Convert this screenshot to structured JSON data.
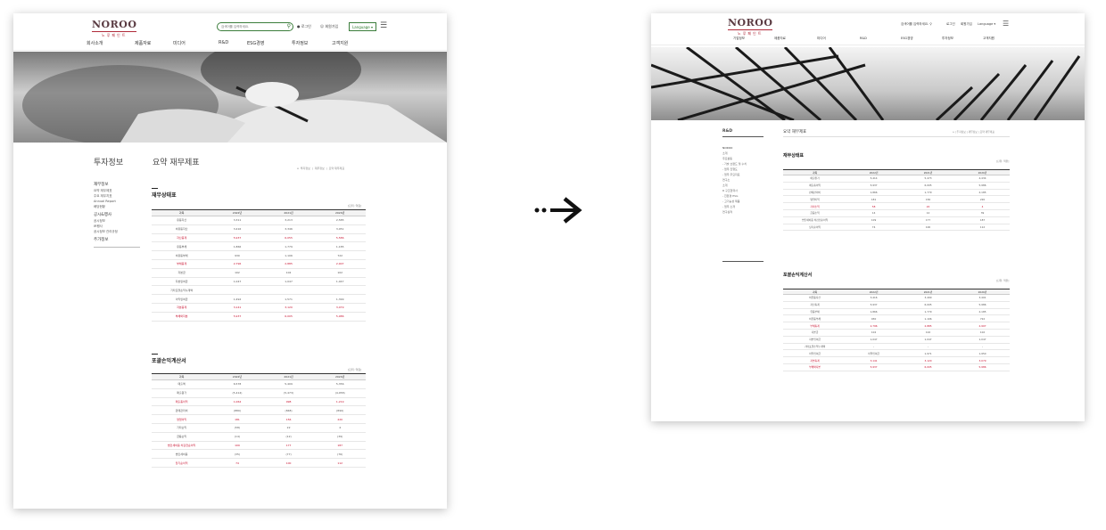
{
  "left": {
    "header": {
      "logo": "NOROO",
      "logo_sub": "노루페인트",
      "search_placeholder": "검색어를 입력하세요.",
      "login": "로그인",
      "join": "회원가입",
      "language": "Language",
      "nav": [
        "회사소개",
        "제품자료",
        "미디어",
        "R&D",
        "ESG경영",
        "투자정보",
        "고객지원"
      ]
    },
    "section_title": "투자정보",
    "page_title": "요약 재무제표",
    "breadcrumb": [
      "투자정보",
      "재무정보",
      "요약 재무제표"
    ],
    "sidebar": {
      "groups": [
        {
          "label": "재무정보",
          "active": true,
          "items": [
            "요약 재무제표",
            "주요 재무지표",
            "Annual Report",
            "배당현황"
          ]
        },
        {
          "label": "공시&행사",
          "active": false,
          "items": [
            "공시정보",
            "IR행사",
            "공시정보 관리규정"
          ]
        },
        {
          "label": "주가정보",
          "active": false,
          "items": []
        }
      ]
    },
    "balance": {
      "title": "재무상태표",
      "unit": "[단위: 억원]",
      "headers": [
        "과목",
        "2022년",
        "2021년",
        "2020년"
      ],
      "rows": [
        {
          "cells": [
            "유동자산",
            "3,311",
            "3,213",
            "2,585"
          ],
          "red": false
        },
        {
          "cells": [
            "비유동자산",
            "3,416",
            "3,346",
            "3,051"
          ],
          "red": false
        },
        {
          "cells": [
            "자산총계",
            "5,937",
            "6,055",
            "5,586"
          ],
          "red": true
        },
        {
          "cells": [
            "유동부채",
            "1,866",
            "1,779",
            "1,185"
          ],
          "red": false
        },
        {
          "cells": [
            "비유동부채",
            "930",
            "1,106",
            "722"
          ],
          "red": false
        },
        {
          "cells": [
            "부채총계",
            "2,796",
            "2,885",
            "2,907"
          ],
          "red": true
        },
        {
          "cells": [
            "자본금",
            "102",
            "102",
            "102"
          ],
          "red": false
        },
        {
          "cells": [
            "자본잉여금",
            "1,047",
            "1,047",
            "1,047"
          ],
          "red": false
        },
        {
          "cells": [
            "기타포괄손익누계액",
            "",
            "",
            ""
          ],
          "red": false
        },
        {
          "cells": [
            "이익잉여금",
            "1,492",
            "1,571",
            "1,399"
          ],
          "red": false
        },
        {
          "cells": [
            "자본총계",
            "3,141",
            "3,120",
            "3,079"
          ],
          "red": true
        },
        {
          "cells": [
            "부채와자본",
            "5,937",
            "6,005",
            "5,986"
          ],
          "red": true
        }
      ]
    },
    "income": {
      "title": "포괄손익계산서",
      "unit": "[단위: 억원]",
      "headers": [
        "과목",
        "2022년",
        "2021년",
        "2020년"
      ],
      "rows": [
        {
          "cells": [
            "매출액",
            "6,578",
            "5,409",
            "5,356"
          ],
          "red": false
        },
        {
          "cells": [
            "매출원가",
            "(5,414)",
            "(5,473)",
            "(4,058)"
          ],
          "red": false
        },
        {
          "cells": [
            "매출총이익",
            "1,064",
            "998",
            "1,219"
          ],
          "red": true
        },
        {
          "cells": [
            "판매관리비",
            "(889)",
            "(848)",
            "(890)"
          ],
          "red": false
        },
        {
          "cells": [
            "영업이익",
            "181",
            "156",
            "220"
          ],
          "red": true
        },
        {
          "cells": [
            "기타손익",
            "(58)",
            "22",
            "4"
          ],
          "red": false
        },
        {
          "cells": [
            "금융손익",
            "(14)",
            "(12)",
            "(39)"
          ],
          "red": false
        },
        {
          "cells": [
            "법인세비용 차감전순이익",
            "109",
            "177",
            "187"
          ],
          "red": true
        },
        {
          "cells": [
            "법인세비용",
            "(35)",
            "(77)",
            "(76)"
          ],
          "red": false
        },
        {
          "cells": [
            "당기순이익",
            "74",
            "100",
            "112"
          ],
          "red": true
        }
      ]
    }
  },
  "right": {
    "header": {
      "logo": "NOROO",
      "logo_sub": "노루페인트",
      "search_placeholder": "검색어를 입력하세요.",
      "login": "로그인",
      "join": "회원가입",
      "language": "Language",
      "nav": [
        "기업정보",
        "제품자료",
        "미디어",
        "R&D",
        "ESG경영",
        "투자정보",
        "고객지원"
      ]
    },
    "section_title": "R&D",
    "page_title": "요약 재무제표",
    "breadcrumb": [
      "투자정보",
      "재무정보",
      "요약 재무제표"
    ],
    "sidebar": [
      "NOROO",
      "소개",
      "주요활동",
      "- 기술 브랜드 및 수치",
      "- 업무 진행도",
      "- 업무 주요지표",
      "연구소",
      "소개",
      "R 구조협력사",
      "- 친환경 ESG",
      "- 고기능성 제품",
      "- 업무 소개",
      "연구실적"
    ],
    "balance": {
      "title": "재무상태표",
      "unit": "[단위: 억원]",
      "headers": [
        "과목",
        "2022년",
        "2021년",
        "2020년"
      ],
      "rows": [
        {
          "cells": [
            "매출원가",
            "5,414",
            "5,473",
            "4,434"
          ],
          "red": false
        },
        {
          "cells": [
            "매출총이익",
            "5,937",
            "6,005",
            "5,986"
          ],
          "red": false
        },
        {
          "cells": [
            "판매관리비",
            "1,866",
            "1,779",
            "2,185"
          ],
          "red": false
        },
        {
          "cells": [
            "영업이익",
            "181",
            "156",
            "220"
          ],
          "red": false
        },
        {
          "cells": [
            "기타손익",
            "58",
            "22",
            "4"
          ],
          "red": true
        },
        {
          "cells": [
            "금융손익",
            "14",
            "12",
            "39"
          ],
          "red": false
        },
        {
          "cells": [
            "법인세비용 차감전순이익",
            "109",
            "177",
            "187"
          ],
          "red": false
        },
        {
          "cells": [
            "당기순이익",
            "74",
            "100",
            "112"
          ],
          "red": false
        }
      ]
    },
    "income": {
      "title": "포괄손익계산서",
      "unit": "[단위: 억원]",
      "headers": [
        "과목",
        "2022년",
        "2021년",
        "2020년"
      ],
      "rows": [
        {
          "cells": [
            "비유동자산",
            "3,416",
            "3,490",
            "3,401"
          ],
          "red": false
        },
        {
          "cells": [
            "자산총계",
            "5,937",
            "6,005",
            "5,986"
          ],
          "red": false
        },
        {
          "cells": [
            "유동부채",
            "1,866",
            "1,779",
            "2,185"
          ],
          "red": false
        },
        {
          "cells": [
            "비유동부채",
            "930",
            "1,106",
            "722"
          ],
          "red": false
        },
        {
          "cells": [
            "부채총계",
            "2,796",
            "2,885",
            "2,907"
          ],
          "red": true
        },
        {
          "cells": [
            "자본금",
            "102",
            "102",
            "102"
          ],
          "red": false
        },
        {
          "cells": [
            "자본잉여금",
            "1,047",
            "1,047",
            "1,047"
          ],
          "red": false
        },
        {
          "cells": [
            "기타포괄손익누계액",
            "-",
            "-",
            "-"
          ],
          "red": false
        },
        {
          "cells": [
            "이익잉여금",
            "이익잉여금",
            "1,971",
            "1,950"
          ],
          "red": false
        },
        {
          "cells": [
            "자본총계",
            "3,141",
            "3,120",
            "3,079"
          ],
          "red": true
        },
        {
          "cells": [
            "부채와자본",
            "5,937",
            "6,005",
            "5,986"
          ],
          "red": true
        }
      ]
    }
  },
  "colors": {
    "accent": "#c8102e",
    "brand_green": "#2f7a2f",
    "logo": "#5a3b42"
  }
}
